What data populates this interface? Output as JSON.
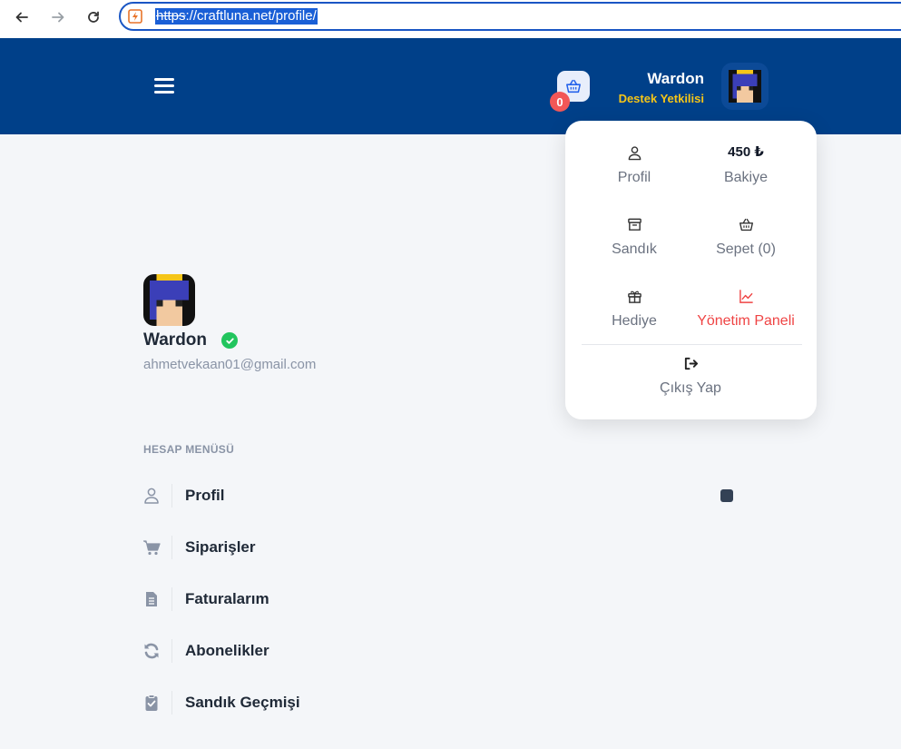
{
  "browser": {
    "url_scheme": "https",
    "url_rest": "://craftluna.net/profile/"
  },
  "header": {
    "cart_count": "0",
    "user_name": "Wardon",
    "user_role": "Destek Yetkilisi"
  },
  "dropdown": {
    "profile_label": "Profil",
    "balance_value": "450 ₺",
    "balance_label": "Bakiye",
    "chest_label": "Sandık",
    "cart_label": "Sepet (0)",
    "gift_label": "Hediye",
    "admin_label": "Yönetim Paneli",
    "logout_label": "Çıkış Yap"
  },
  "profile": {
    "name": "Wardon",
    "email": "ahmetvekaan01@gmail.com"
  },
  "account_menu": {
    "heading": "HESAP MENÜSÜ",
    "items": [
      {
        "label": "Profil",
        "icon": "user-icon"
      },
      {
        "label": "Siparişler",
        "icon": "cart-icon"
      },
      {
        "label": "Faturalarım",
        "icon": "invoice-icon"
      },
      {
        "label": "Abonelikler",
        "icon": "refresh-icon"
      },
      {
        "label": "Sandık Geçmişi",
        "icon": "clipboard-check-icon"
      }
    ]
  },
  "colors": {
    "header_bg": "#004089",
    "role_color": "#f5c518",
    "badge_red": "#f25757",
    "admin_red": "#ef4444",
    "verified_green": "#22c55e"
  }
}
